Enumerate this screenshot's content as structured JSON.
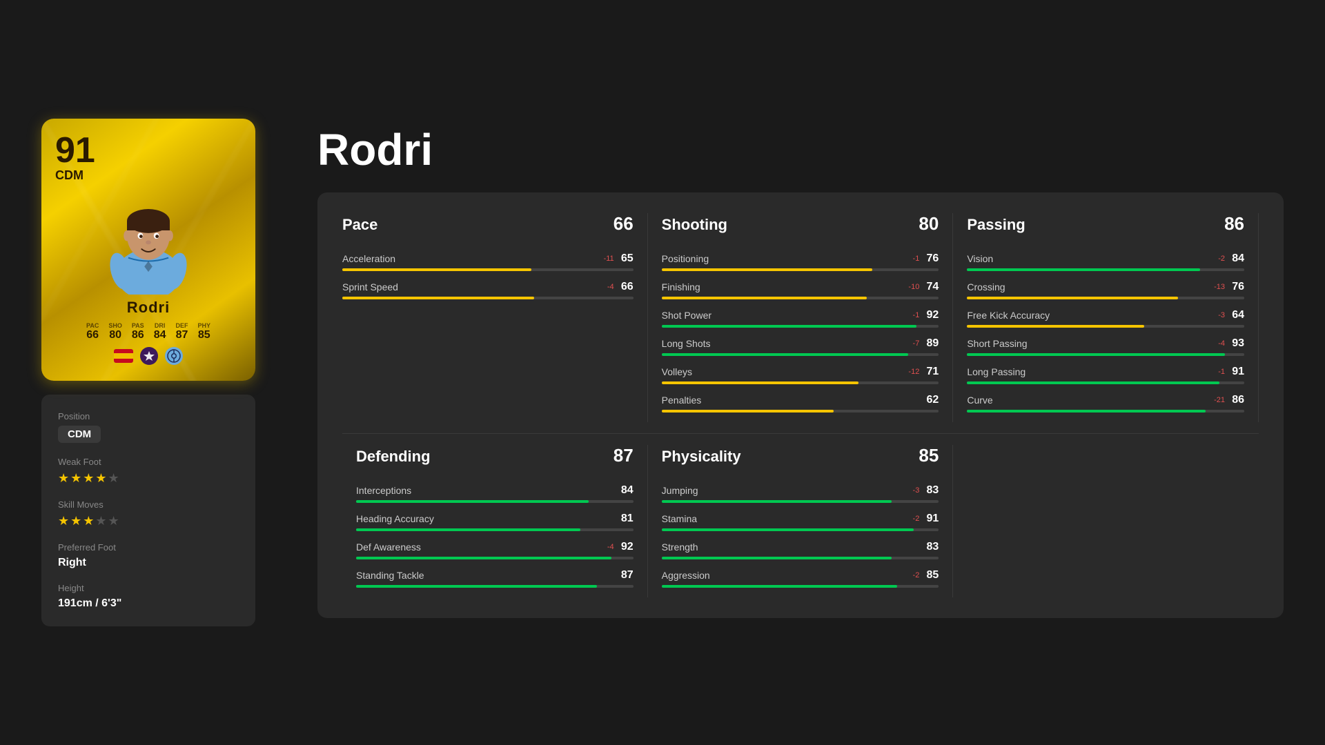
{
  "player": {
    "name": "Rodri",
    "rating": "91",
    "position": "CDM",
    "image_placeholder": "player",
    "stats_summary": {
      "pac": "66",
      "sho": "80",
      "pas": "86",
      "dri": "84",
      "def": "87",
      "phy": "85"
    },
    "info": {
      "position_label": "Position",
      "position_value": "CDM",
      "weak_foot_label": "Weak Foot",
      "weak_foot_stars": 4,
      "skill_moves_label": "Skill Moves",
      "skill_moves_stars": 3,
      "preferred_foot_label": "Preferred Foot",
      "preferred_foot_value": "Right",
      "height_label": "Height",
      "height_value": "191cm / 6'3\""
    }
  },
  "categories": {
    "pace": {
      "title": "Pace",
      "value": "66",
      "stats": [
        {
          "name": "Acceleration",
          "modifier": "-11",
          "value": "65",
          "bar_pct": 65
        },
        {
          "name": "Sprint Speed",
          "modifier": "-4",
          "value": "66",
          "bar_pct": 66
        }
      ]
    },
    "shooting": {
      "title": "Shooting",
      "value": "80",
      "stats": [
        {
          "name": "Positioning",
          "modifier": "-1",
          "value": "76",
          "bar_pct": 76
        },
        {
          "name": "Finishing",
          "modifier": "-10",
          "value": "74",
          "bar_pct": 74
        },
        {
          "name": "Shot Power",
          "modifier": "-1",
          "value": "92",
          "bar_pct": 92
        },
        {
          "name": "Long Shots",
          "modifier": "-7",
          "value": "89",
          "bar_pct": 89
        },
        {
          "name": "Volleys",
          "modifier": "-12",
          "value": "71",
          "bar_pct": 71
        },
        {
          "name": "Penalties",
          "modifier": "",
          "value": "62",
          "bar_pct": 62
        }
      ]
    },
    "passing": {
      "title": "Passing",
      "value": "86",
      "stats": [
        {
          "name": "Vision",
          "modifier": "-2",
          "value": "84",
          "bar_pct": 84
        },
        {
          "name": "Crossing",
          "modifier": "-13",
          "value": "76",
          "bar_pct": 76
        },
        {
          "name": "Free Kick Accuracy",
          "modifier": "-3",
          "value": "64",
          "bar_pct": 64
        },
        {
          "name": "Short Passing",
          "modifier": "-4",
          "value": "93",
          "bar_pct": 93
        },
        {
          "name": "Long Passing",
          "modifier": "-1",
          "value": "91",
          "bar_pct": 91
        },
        {
          "name": "Curve",
          "modifier": "-21",
          "value": "86",
          "bar_pct": 86
        }
      ]
    },
    "defending": {
      "title": "Defending",
      "value": "87",
      "stats": [
        {
          "name": "Interceptions",
          "modifier": "",
          "value": "84",
          "bar_pct": 84
        },
        {
          "name": "Heading Accuracy",
          "modifier": "",
          "value": "81",
          "bar_pct": 81
        },
        {
          "name": "Def Awareness",
          "modifier": "-4",
          "value": "92",
          "bar_pct": 92
        },
        {
          "name": "Standing Tackle",
          "modifier": "",
          "value": "87",
          "bar_pct": 87
        }
      ]
    },
    "physicality": {
      "title": "Physicality",
      "value": "85",
      "stats": [
        {
          "name": "Jumping",
          "modifier": "-3",
          "value": "83",
          "bar_pct": 83
        },
        {
          "name": "Stamina",
          "modifier": "-2",
          "value": "91",
          "bar_pct": 91
        },
        {
          "name": "Strength",
          "modifier": "",
          "value": "83",
          "bar_pct": 83
        },
        {
          "name": "Aggression",
          "modifier": "-2",
          "value": "85",
          "bar_pct": 85
        }
      ]
    }
  }
}
